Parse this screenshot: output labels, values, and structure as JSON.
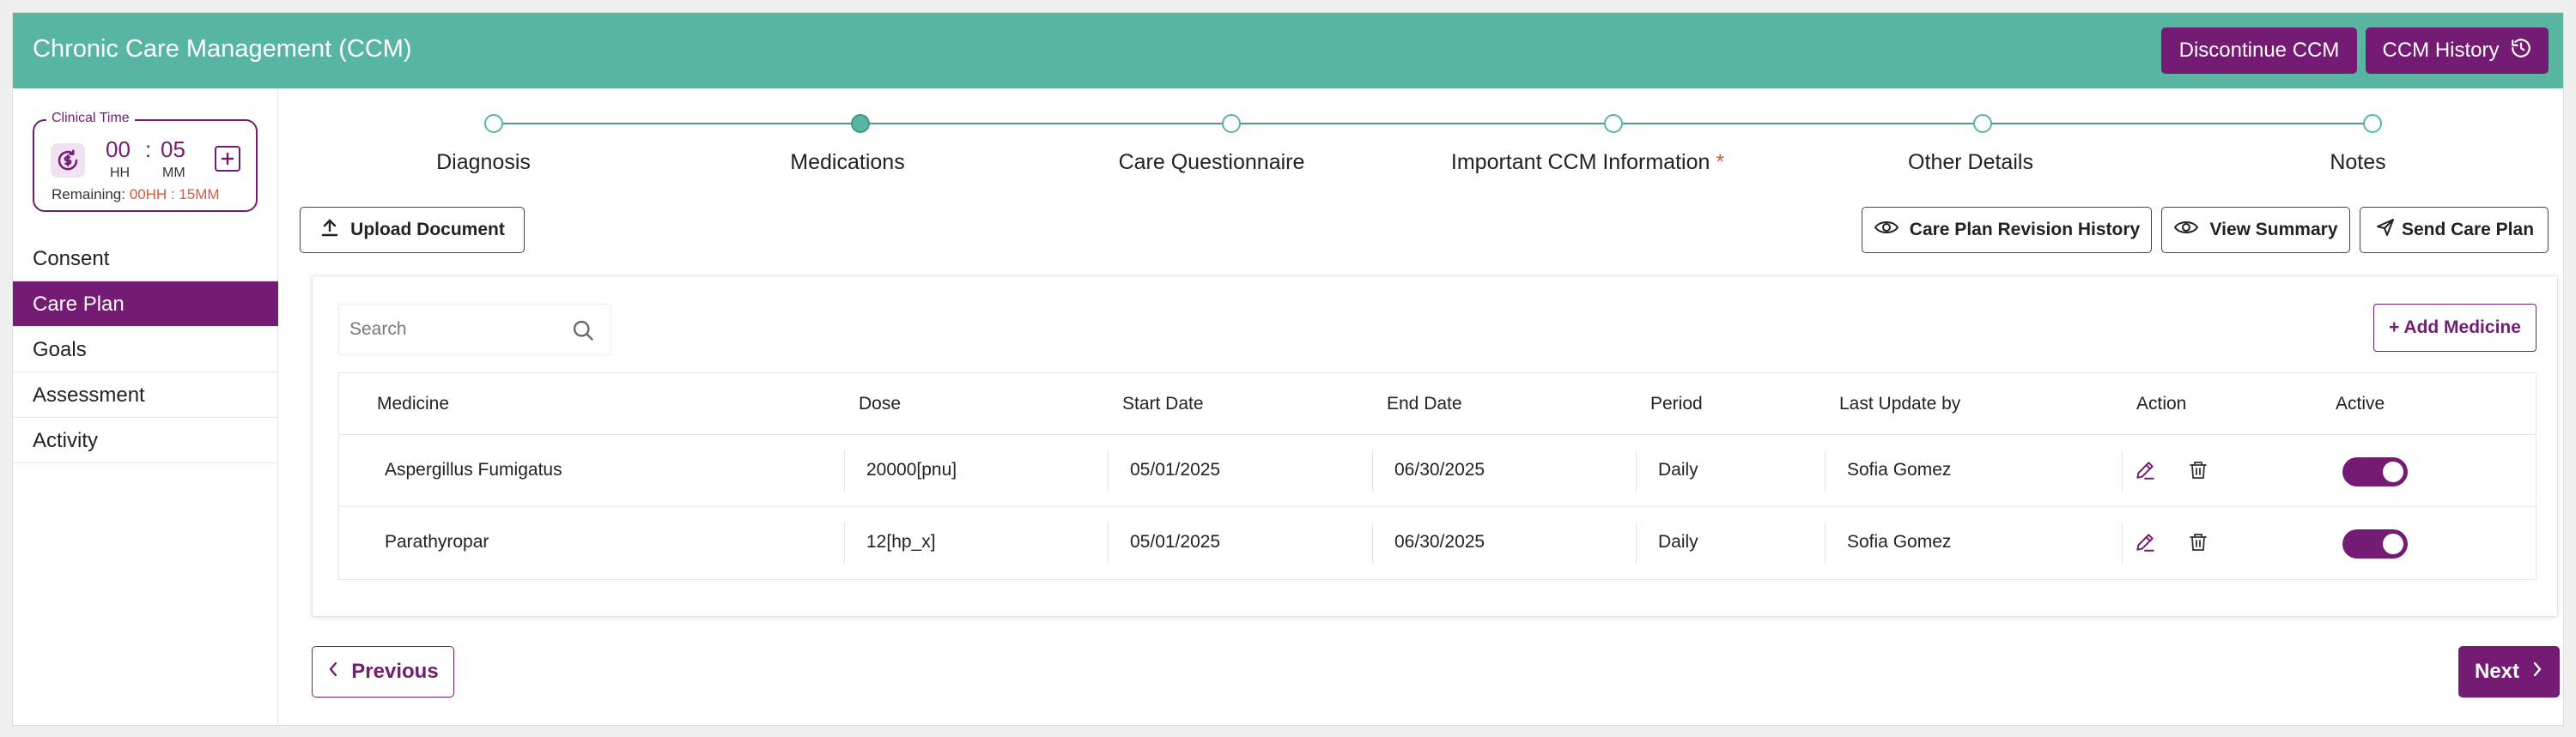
{
  "header": {
    "title": "Chronic Care Management (CCM)",
    "discontinue_label": "Discontinue CCM",
    "history_label": "CCM History",
    "history_icon": "history-icon"
  },
  "clinical_time": {
    "legend": "Clinical Time",
    "hours": "00",
    "minutes": "05",
    "hours_label": "HH",
    "minutes_label": "MM",
    "remaining_label": "Remaining:",
    "remaining_value": "00HH : 15MM"
  },
  "sidebar": {
    "items": [
      {
        "label": "Consent"
      },
      {
        "label": "Care Plan",
        "active": true
      },
      {
        "label": "Goals"
      },
      {
        "label": "Assessment"
      },
      {
        "label": "Activity"
      }
    ]
  },
  "stepper": {
    "steps": [
      {
        "label": "Diagnosis"
      },
      {
        "label": "Medications",
        "current": true
      },
      {
        "label": "Care Questionnaire"
      },
      {
        "label": "Important CCM Information",
        "required_mark": "*"
      },
      {
        "label": "Other Details"
      },
      {
        "label": "Notes"
      }
    ]
  },
  "toolbar": {
    "upload_label": "Upload Document",
    "revision_label": "Care Plan Revision History",
    "summary_label": "View Summary",
    "send_label": "Send Care Plan"
  },
  "medications": {
    "search_placeholder": "Search",
    "add_label": "+ Add Medicine",
    "columns": [
      "Medicine",
      "Dose",
      "Start Date",
      "End Date",
      "Period",
      "Last Update by",
      "Action",
      "Active"
    ],
    "rows": [
      {
        "medicine": "Aspergillus Fumigatus",
        "dose": "20000[pnu]",
        "start_date": "05/01/2025",
        "end_date": "06/30/2025",
        "period": "Daily",
        "last_update_by": "Sofia Gomez",
        "active": true
      },
      {
        "medicine": "Parathyropar",
        "dose": "12[hp_x]",
        "start_date": "05/01/2025",
        "end_date": "06/30/2025",
        "period": "Daily",
        "last_update_by": "Sofia Gomez",
        "active": true
      }
    ]
  },
  "nav": {
    "previous_label": "Previous",
    "next_label": "Next"
  },
  "colors": {
    "header_teal": "#57b5a2",
    "brand_purple": "#741b74",
    "alert_red": "#e0533b"
  }
}
